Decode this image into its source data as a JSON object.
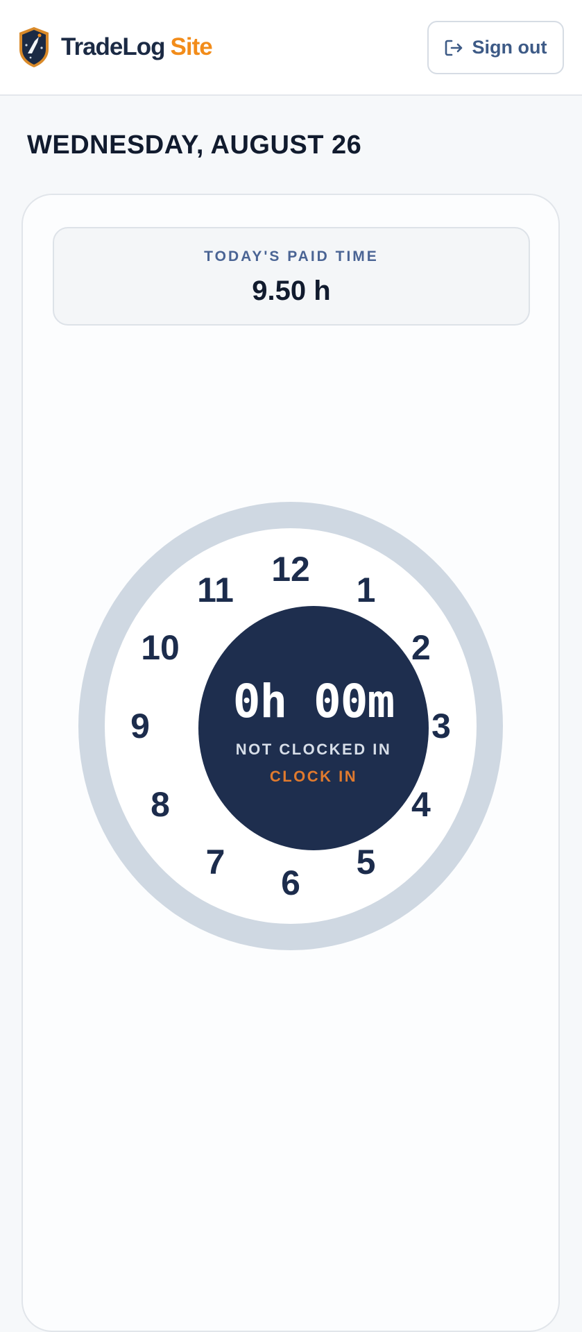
{
  "header": {
    "brand_primary": "TradeLog",
    "brand_secondary": "Site",
    "sign_out_label": "Sign out",
    "sign_out_icon": "logout-icon",
    "logo_icon": "shield-logo-icon"
  },
  "date_heading": "WEDNESDAY, AUGUST 26",
  "paid_time": {
    "label": "TODAY'S PAID TIME",
    "value": "9.50 h"
  },
  "clock": {
    "elapsed": "0h 00m",
    "status": "NOT CLOCKED IN",
    "action_label": "CLOCK IN",
    "hour_numbers": [
      "12",
      "1",
      "2",
      "3",
      "4",
      "5",
      "6",
      "7",
      "8",
      "9",
      "10",
      "11"
    ]
  },
  "colors": {
    "brand_navy": "#1b2a44",
    "brand_orange": "#f28c1a",
    "hub_navy": "#1e2e4e",
    "action_orange": "#e07a2e",
    "ring_gray": "#cfd8e2",
    "label_blue": "#4a6494"
  }
}
